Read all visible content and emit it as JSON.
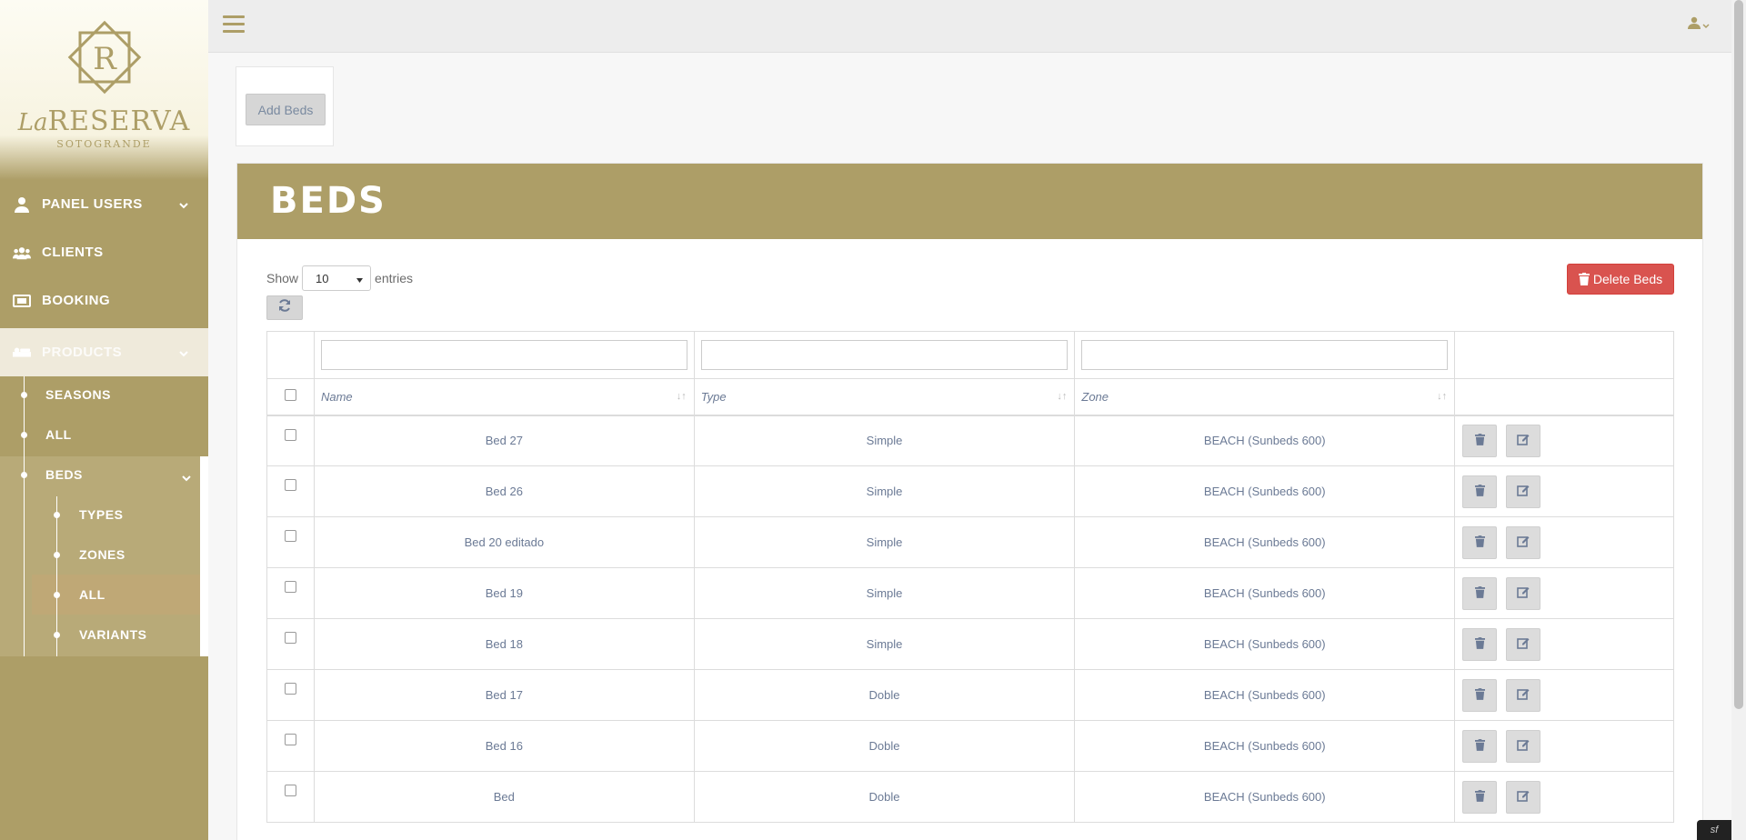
{
  "brand": {
    "la": "La",
    "name": "RESERVA",
    "sub": "SOTOGRANDE",
    "monogram": "R"
  },
  "sidebar": {
    "items": [
      {
        "label": "PANEL USERS",
        "icon": "user-icon"
      },
      {
        "label": "CLIENTS",
        "icon": "users-icon"
      },
      {
        "label": "BOOKING",
        "icon": "ticket-icon"
      },
      {
        "label": "PRODUCTS",
        "icon": "bed-icon"
      }
    ],
    "products_sub": [
      "SEASONS",
      "ALL",
      "BEDS"
    ],
    "beds_sub": [
      "TYPES",
      "ZONES",
      "ALL",
      "VARIANTS"
    ]
  },
  "toolbar": {
    "add_label": "Add Beds",
    "delete_label": "Delete Beds"
  },
  "panel": {
    "title": "BEDS"
  },
  "length": {
    "show": "Show",
    "value": "10",
    "entries": "entries"
  },
  "table": {
    "headers": {
      "name": "Name",
      "type": "Type",
      "zone": "Zone"
    },
    "rows": [
      {
        "name": "Bed 27",
        "type": "Simple",
        "zone": "BEACH (Sunbeds 600)"
      },
      {
        "name": "Bed 26",
        "type": "Simple",
        "zone": "BEACH (Sunbeds 600)"
      },
      {
        "name": "Bed 20 editado",
        "type": "Simple",
        "zone": "BEACH (Sunbeds 600)"
      },
      {
        "name": "Bed 19",
        "type": "Simple",
        "zone": "BEACH (Sunbeds 600)"
      },
      {
        "name": "Bed 18",
        "type": "Simple",
        "zone": "BEACH (Sunbeds 600)"
      },
      {
        "name": "Bed 17",
        "type": "Doble",
        "zone": "BEACH (Sunbeds 600)"
      },
      {
        "name": "Bed 16",
        "type": "Doble",
        "zone": "BEACH (Sunbeds 600)"
      },
      {
        "name": "Bed",
        "type": "Doble",
        "zone": "BEACH (Sunbeds 600)"
      }
    ]
  },
  "colors": {
    "brand": "#ad9e67",
    "danger": "#d9534f"
  },
  "footer": {
    "sf": "sf"
  }
}
